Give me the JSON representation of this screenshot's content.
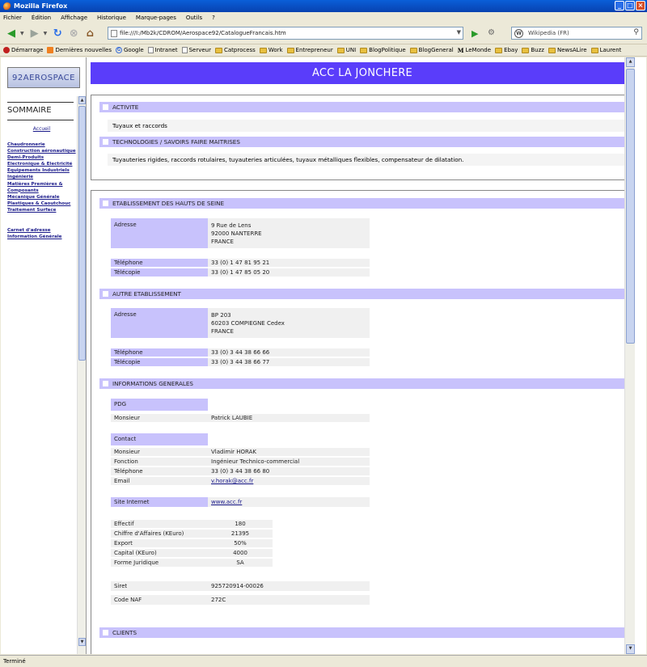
{
  "window": {
    "title": "Mozilla Firefox"
  },
  "menu": [
    "Fichier",
    "Édition",
    "Affichage",
    "Historique",
    "Marque-pages",
    "Outils",
    "?"
  ],
  "nav": {
    "url": "file:///I:/Mb2k/CDROM/Aerospace92/CatalogueFrancais.htm",
    "search_value": "Wikipedia (FR)"
  },
  "bookmarks": [
    "Démarrage",
    "Dernières nouvelles",
    "Google",
    "Intranet",
    "Serveur",
    "Catprocess",
    "Work",
    "Entrepreneur",
    "UNI",
    "BlogPolitique",
    "BlogGeneral",
    "LeMonde",
    "Ebay",
    "Buzz",
    "NewsALire",
    "Laurent"
  ],
  "left": {
    "logo": "92AEROSPACE",
    "sommaire": "SOMMAIRE",
    "accueil": "Accueil",
    "links": [
      "Chaudronnerie",
      "Construction aéronautique",
      "Demi-Produits",
      "Electronique & Electricité",
      "Equipements Industriels",
      "Ingénierie",
      "Matières Premières & Composants",
      "Mécanique Générale",
      "Plastiques & Caoutchouc",
      "Traitement Surface"
    ],
    "links2": [
      "Carnet d'adresse",
      "Information Générale"
    ]
  },
  "main": {
    "title": "ACC LA JONCHERE",
    "activite_title": "ACTIVITE",
    "activite_text": "Tuyaux et raccords",
    "tech_title": "TECHNOLOGIES / SAVOIRS FAIRE MAITRISES",
    "tech_text": "Tuyauteries rigides, raccords rotulaires, tuyauteries articulées, tuyaux métalliques flexibles, compensateur de dilatation.",
    "etab_title": "ETABLISSEMENT DES HAUTS DE SEINE",
    "etab": {
      "adresse_label": "Adresse",
      "adresse_lines": [
        "9 Rue de Lens",
        "92000 NANTERRE",
        "FRANCE"
      ],
      "tel_label": "Téléphone",
      "tel": "33 (0) 1 47 81 95 21",
      "fax_label": "Télécopie",
      "fax": "33 (0) 1 47 85 05 20"
    },
    "autre_title": "AUTRE ETABLISSEMENT",
    "autre": {
      "adresse_label": "Adresse",
      "adresse_lines": [
        "BP 203",
        "60203 COMPIEGNE Cedex",
        "FRANCE"
      ],
      "tel_label": "Téléphone",
      "tel": "33 (0) 3 44 38 66 66",
      "fax_label": "Télécopie",
      "fax": "33 (0) 3 44 38 66 77"
    },
    "info_title": "INFORMATIONS GENERALES",
    "info": {
      "pdg_label": "PDG",
      "pdg_civ": "Monsieur",
      "pdg_name": "Patrick LAUBIE",
      "contact_label": "Contact",
      "contact_civ": "Monsieur",
      "contact_name": "Vladimir HORAK",
      "fonction_label": "Fonction",
      "fonction": "Ingénieur Technico-commercial",
      "tel_label": "Téléphone",
      "tel": "33 (0) 3 44 38 66 80",
      "email_label": "Email",
      "email": "v.horak@acc.fr",
      "site_label": "Site Internet",
      "site": "www.acc.fr",
      "effectif_label": "Effectif",
      "effectif": "180",
      "ca_label": "Chiffre d'Affaires (KEuro)",
      "ca": "21395",
      "export_label": "Export",
      "export": "50%",
      "capital_label": "Capital (KEuro)",
      "capital": "4000",
      "forme_label": "Forme Juridique",
      "forme": "SA",
      "siret_label": "Siret",
      "siret": "925720914-00026",
      "naf_label": "Code NAF",
      "naf": "272C"
    },
    "clients_title": "CLIENTS"
  },
  "status": "Terminé"
}
